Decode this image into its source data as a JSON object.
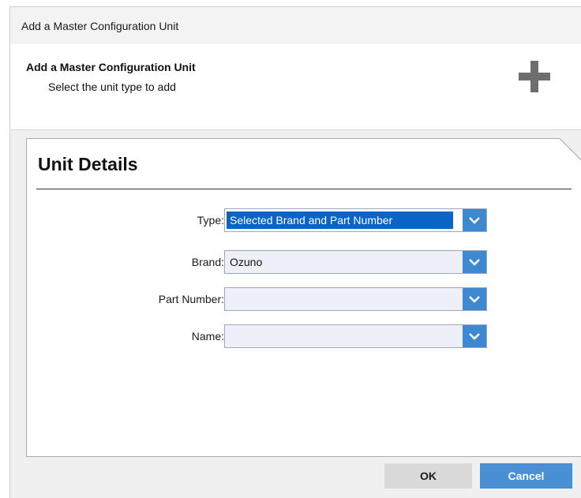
{
  "window": {
    "title": "Add a Master Configuration Unit"
  },
  "header": {
    "title": "Add a Master Configuration Unit",
    "subtitle": "Select the unit type to add",
    "icon": "plus-icon"
  },
  "unit_details": {
    "title": "Unit Details",
    "fields": [
      {
        "label": "Type:",
        "value": "Selected Brand and Part Number"
      },
      {
        "label": "Brand:",
        "value": "Ozuno"
      },
      {
        "label": "Part Number:",
        "value": ""
      },
      {
        "label": "Name:",
        "value": ""
      }
    ]
  },
  "footer": {
    "ok_label": "OK",
    "cancel_label": "Cancel"
  },
  "colors": {
    "accent": "#3d88d0",
    "selection": "#0a64c8",
    "cancel": "#4a8fd4",
    "icon": "#6e6e6e"
  }
}
